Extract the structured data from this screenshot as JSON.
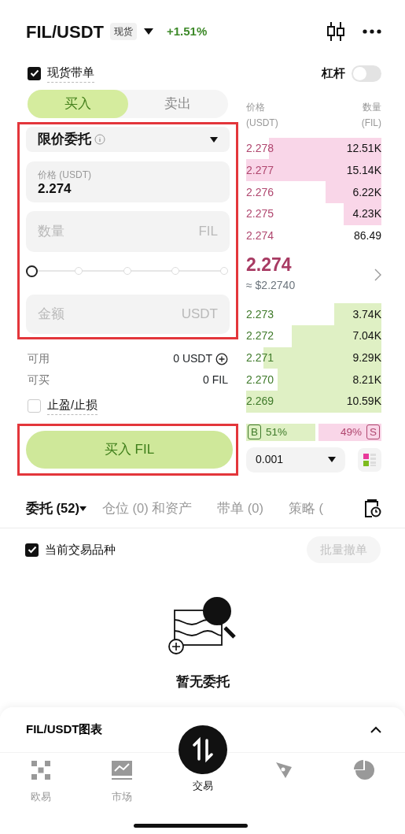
{
  "header": {
    "pair": "FIL/USDT",
    "market_tag": "现货",
    "change": "+1.51%"
  },
  "copy_trade": {
    "label": "现货带单",
    "checked": true
  },
  "leverage": {
    "label": "杠杆",
    "on": false
  },
  "side_tabs": [
    {
      "label": "买入",
      "selected": true
    },
    {
      "label": "卖出",
      "selected": false
    }
  ],
  "order_form": {
    "highlighted": true,
    "order_type": "限价委托",
    "price_label": "价格 (USDT)",
    "price_value": "2.274",
    "amount_placeholder": "数量",
    "amount_unit": "FIL",
    "slider": {
      "level": 0
    },
    "total_placeholder": "金额",
    "total_unit": "USDT"
  },
  "balances": [
    {
      "label": "可用",
      "value": "0 USDT",
      "kind": "deposit"
    },
    {
      "label": "可买",
      "value": "0 FIL",
      "kind": "plain"
    }
  ],
  "tp_sl": {
    "label": "止盈/止损",
    "checked": false
  },
  "submit": {
    "label": "买入 FIL",
    "highlighted": true
  },
  "order_book": {
    "price_header": "价格",
    "price_unit": "(USDT)",
    "qty_header": "数量",
    "qty_unit": "(FIL)",
    "asks": [
      {
        "price": "2.278",
        "qty": "12.51K"
      },
      {
        "price": "2.277",
        "qty": "15.14K"
      },
      {
        "price": "2.276",
        "qty": "6.22K"
      },
      {
        "price": "2.275",
        "qty": "4.23K"
      },
      {
        "price": "2.274",
        "qty": "86.49"
      }
    ],
    "last_price": "2.274",
    "last_price_usd": "≈ $2.2740",
    "bids": [
      {
        "price": "2.273",
        "qty": "3.74K"
      },
      {
        "price": "2.272",
        "qty": "7.04K"
      },
      {
        "price": "2.271",
        "qty": "9.29K"
      },
      {
        "price": "2.270",
        "qty": "8.21K"
      },
      {
        "price": "2.269",
        "qty": "10.59K"
      }
    ],
    "buy_letter": "B",
    "buy_ratio": "51%",
    "sell_ratio": "49%",
    "sell_letter": "S",
    "precision": "0.001"
  },
  "order_tabs": [
    {
      "label": "委托 (52)",
      "selected": true,
      "dropdown": true
    },
    {
      "label": "仓位 (0) 和资产",
      "selected": false,
      "dropdown": false
    },
    {
      "label": "带单 (0)",
      "selected": false,
      "dropdown": false
    },
    {
      "label": "策略 (",
      "selected": false,
      "dropdown": false
    }
  ],
  "pair_filter": {
    "label": "当前交易品种",
    "checked": true
  },
  "cancel_all": {
    "label": "批量撤单",
    "disabled": true
  },
  "empty_state": {
    "title": "暂无委托"
  },
  "chart_sheet": {
    "title": "FIL/USDT图表",
    "expanded": false
  },
  "bottom_nav": [
    {
      "label": "欧易",
      "kind": "grid",
      "selected": false
    },
    {
      "label": "市场",
      "kind": "chart",
      "selected": false
    },
    {
      "label": "交易",
      "kind": "trade",
      "selected": true
    },
    {
      "kind": "compass",
      "selected": false
    },
    {
      "kind": "pie",
      "selected": false
    }
  ]
}
